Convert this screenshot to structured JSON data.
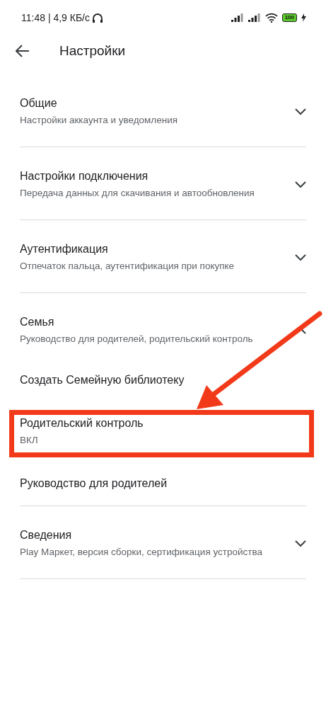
{
  "status_bar": {
    "time_speed": "11:48 | 4,9 КБ/с",
    "battery": "100"
  },
  "header": {
    "title": "Настройки"
  },
  "sections": [
    {
      "title": "Общие",
      "subtitle": "Настройки аккаунта и уведомления",
      "expanded": false
    },
    {
      "title": "Настройки подключения",
      "subtitle": "Передача данных для скачивания и автообновления",
      "expanded": false
    },
    {
      "title": "Аутентификация",
      "subtitle": "Отпечаток пальца, аутентификация при покупке",
      "expanded": false
    },
    {
      "title": "Семья",
      "subtitle": "Руководство для родителей, родительский контроль",
      "expanded": true,
      "children": [
        {
          "title": "Создать Семейную библиотеку",
          "highlighted": false
        },
        {
          "title": "Родительский контроль",
          "subtitle": "ВКЛ",
          "highlighted": true
        },
        {
          "title": "Руководство для родителей",
          "highlighted": false
        }
      ]
    },
    {
      "title": "Сведения",
      "subtitle": "Play Маркет, версия сборки, сертификация устройства",
      "expanded": false
    }
  ]
}
